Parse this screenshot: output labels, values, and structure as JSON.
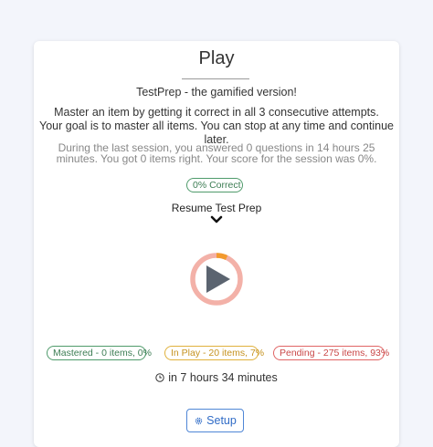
{
  "page": {
    "title": "Play",
    "subtitle": "TestPrep - the gamified version!",
    "description_line1": "Master an item by getting it correct in all 3 consecutive attempts.",
    "description_line2": "Your goal is to master all items. You can stop at any time and continue later.",
    "session_line1": "During the last session, you answered 0 questions in 14 hours 25",
    "session_line2": "minutes. You got 0 items right. Your score for the session was 0%."
  },
  "stats": {
    "correct_label": "0% Correct",
    "mastered_label": "Mastered - 0 items, 0%",
    "in_play_label": "In Play - 20 items, 7%",
    "pending_label": "Pending - 275 items, 93%"
  },
  "resume": {
    "label": "Resume Test Prep",
    "progress_fraction": 0.07
  },
  "timer": {
    "text": "in 7 hours 34 minutes"
  },
  "setup": {
    "label": "Setup"
  },
  "icons": {
    "chevron": "chevron-down-icon",
    "play": "play-icon",
    "clock": "clock-icon",
    "gear": "gear-icon"
  },
  "colors": {
    "mastered": "#3d7d54",
    "in_play": "#c59220",
    "pending": "#c94747",
    "ring": "#f3b1a8",
    "ring_progress": "#f29a2e",
    "accent": "#2f6bc6"
  }
}
